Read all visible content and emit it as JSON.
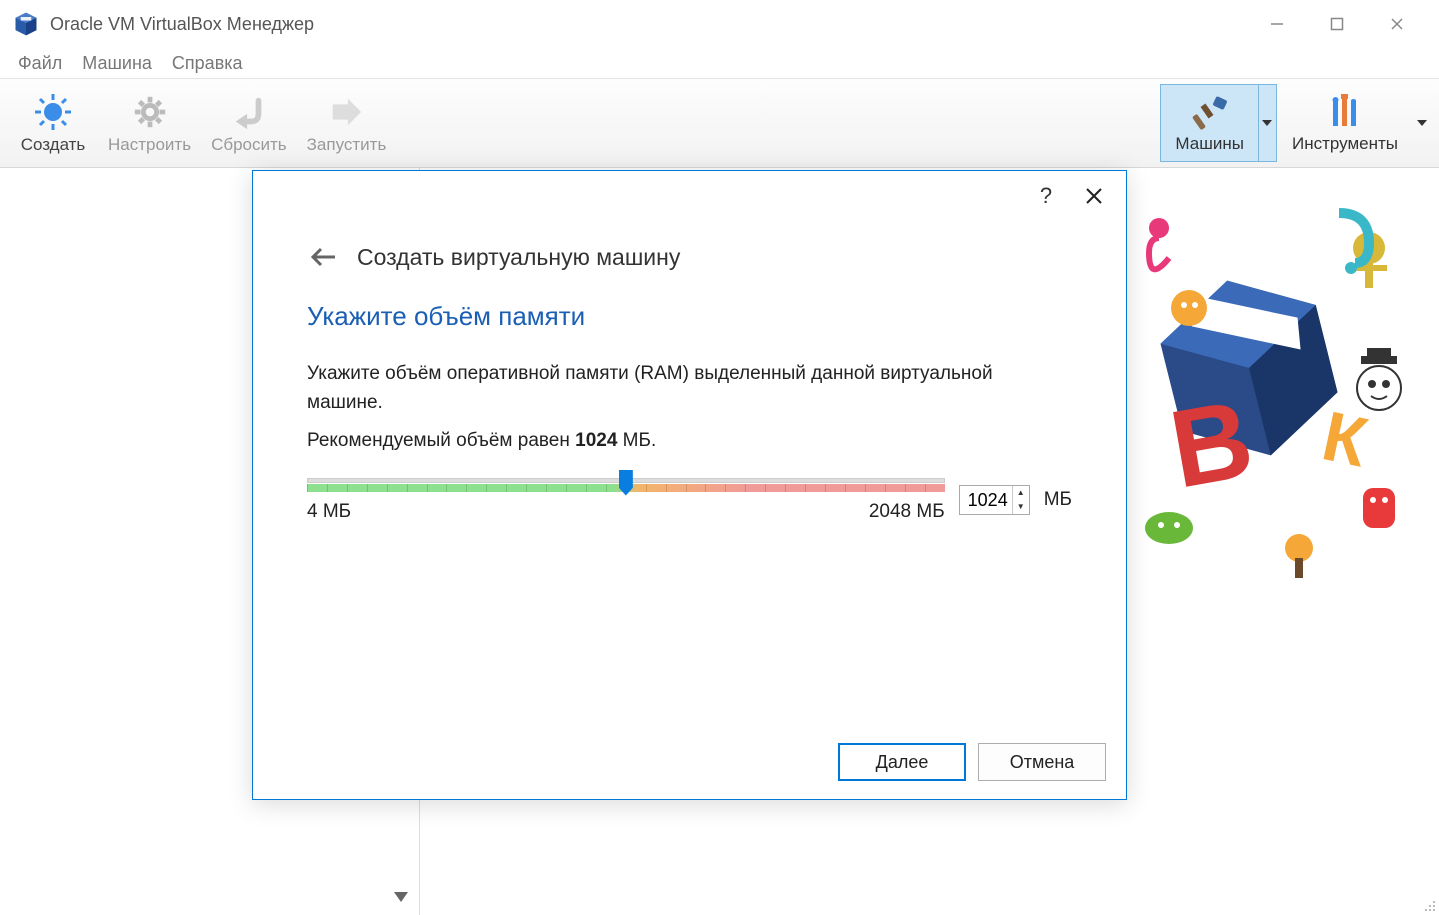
{
  "window": {
    "title": "Oracle VM VirtualBox Менеджер"
  },
  "menu": {
    "file": "Файл",
    "machine": "Машина",
    "help": "Справка"
  },
  "toolbar": {
    "create": "Создать",
    "settings": "Настроить",
    "discard": "Сбросить",
    "start": "Запустить",
    "machines": "Машины",
    "tools": "Инструменты"
  },
  "dialog": {
    "header": "Создать виртуальную машину",
    "title": "Укажите объём памяти",
    "desc": "Укажите объём оперативной памяти (RAM) выделенный данной виртуальной машине.",
    "recommend_prefix": "Рекомендуемый объём равен ",
    "recommend_value": "1024",
    "recommend_suffix": " МБ.",
    "slider_min": "4 МБ",
    "slider_max": "2048 МБ",
    "value": "1024",
    "unit": "МБ",
    "next": "Далее",
    "cancel": "Отмена"
  }
}
